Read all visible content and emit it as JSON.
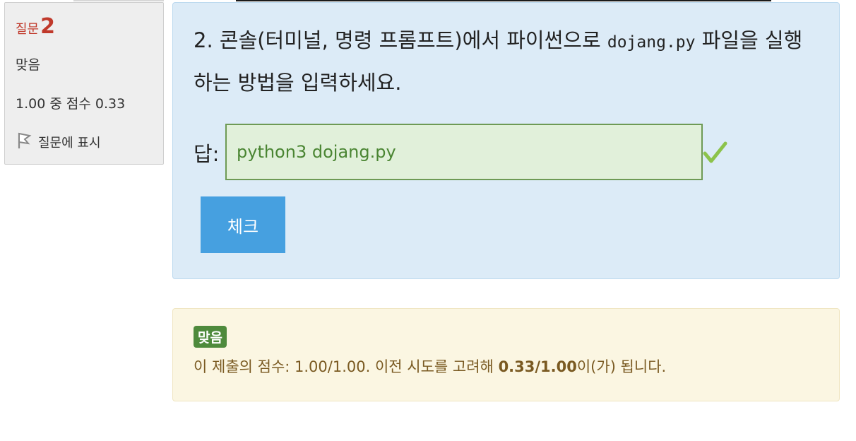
{
  "info": {
    "question_label": "질문",
    "question_number": "2",
    "state": "맞음",
    "grade": "1.00 중 점수 0.33",
    "flag_label": "질문에 표시"
  },
  "question": {
    "text_before": "2. 콘솔(터미널, 명령 프롬프트)에서 파이썬으로 ",
    "code": "dojang.py",
    "text_after": " 파일을 실행하는 방법을 입력하세요.",
    "answer_label": "답:",
    "answer_value": "python3 dojang.py",
    "check_button": "체크"
  },
  "feedback": {
    "badge": "맞음",
    "grading_prefix": "이 제출의 점수: 1.00/1.00. 이전 시도를 고려해 ",
    "grading_bold": "0.33/1.00",
    "grading_suffix": "이(가) 됩니다."
  },
  "colors": {
    "question_number": "#c0392b",
    "correct_badge": "#4e8a3c",
    "check_button": "#46a0e0",
    "checkmark": "#8cc34b"
  },
  "icons": {
    "flag": "flag-icon",
    "correct": "checkmark-icon"
  }
}
